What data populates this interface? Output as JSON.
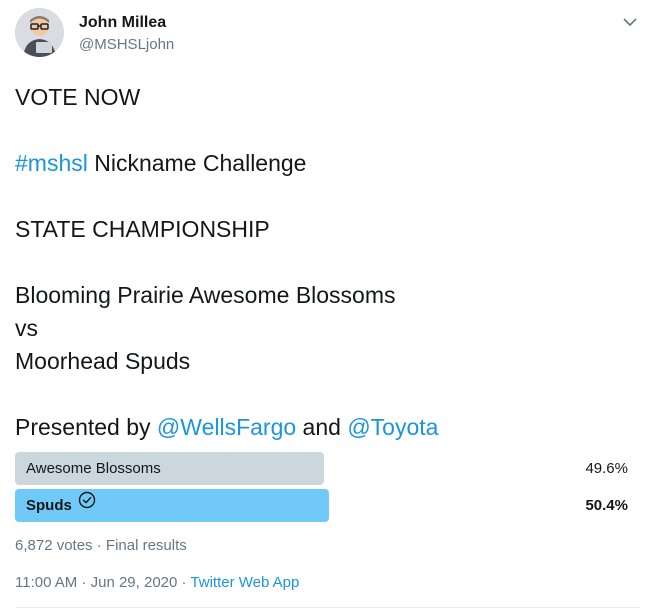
{
  "author": {
    "name": "John Millea",
    "handle": "@MSHSLjohn"
  },
  "tweet": {
    "line1": "VOTE NOW",
    "hashtag": "#mshsl",
    "line2_rest": " Nickname Challenge",
    "line3": "STATE CHAMPIONSHIP",
    "line4": "Blooming Prairie Awesome Blossoms",
    "line5": "vs",
    "line6": "Moorhead Spuds",
    "presented_prefix": "Presented by ",
    "mention1": "@WellsFargo",
    "and_text": " and ",
    "mention2": "@Toyota"
  },
  "poll": {
    "options": [
      {
        "label": "Awesome Blossoms",
        "percent_text": "49.6%",
        "percent": 49.6,
        "winner": false
      },
      {
        "label": "Spuds",
        "percent_text": "50.4%",
        "percent": 50.4,
        "winner": true
      }
    ],
    "votes": "6,872 votes",
    "separator": " · ",
    "status": "Final results"
  },
  "meta": {
    "time": "11:00 AM",
    "separator1": " · ",
    "date": "Jun 29, 2020",
    "separator2": " · ",
    "source": "Twitter Web App"
  },
  "colors": {
    "link": "#1b95e0",
    "winner_bar": "#71c9f8",
    "loser_bar": "#ccd6dd",
    "secondary_text": "#657786"
  },
  "icons": {
    "menu": "chevron-down-icon",
    "winner": "check-circle-icon"
  }
}
